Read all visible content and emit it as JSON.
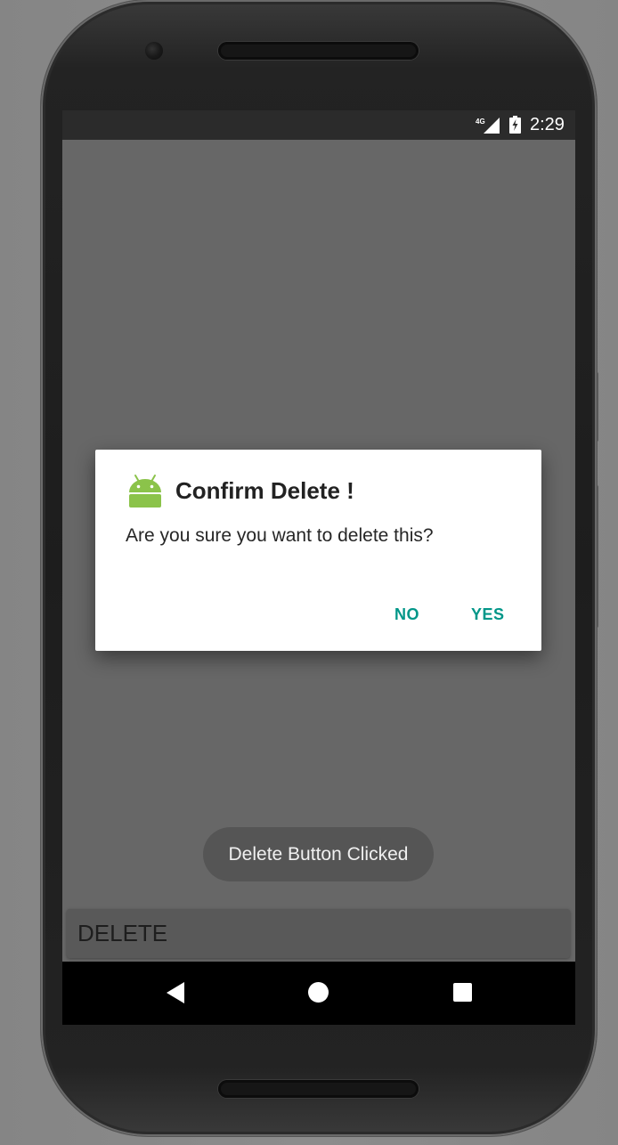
{
  "status_bar": {
    "network_label": "4G",
    "time": "2:29"
  },
  "dialog": {
    "icon": "android-icon",
    "title": "Confirm Delete !",
    "message": "Are you sure you want to delete this?",
    "negative_label": "NO",
    "positive_label": "YES"
  },
  "toast": {
    "text": "Delete Button Clicked"
  },
  "main": {
    "delete_label": "DELETE"
  },
  "nav_bar": {
    "back_icon": "back-icon",
    "home_icon": "home-icon",
    "recents_icon": "recents-icon"
  },
  "colors": {
    "accent": "#009688",
    "android_green": "#8BC34A",
    "scrim": "#676767"
  }
}
